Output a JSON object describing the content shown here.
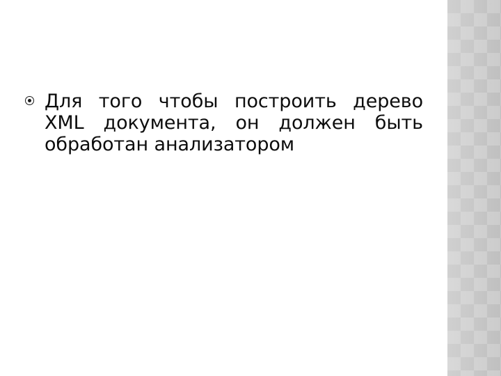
{
  "slide": {
    "background_color": "#ffffff",
    "text_color": "#0d0d0d",
    "body": {
      "bullets": [
        {
          "glyph": "target-bullet",
          "text": "Для того чтобы построить дерево XML документа, он должен быть обработан анализатором"
        }
      ]
    },
    "decoration": {
      "side_band": {
        "name": "diamond-lattice-pattern",
        "base_color": "#bcbcbc",
        "accent_color": "#c9c9c9"
      }
    }
  }
}
